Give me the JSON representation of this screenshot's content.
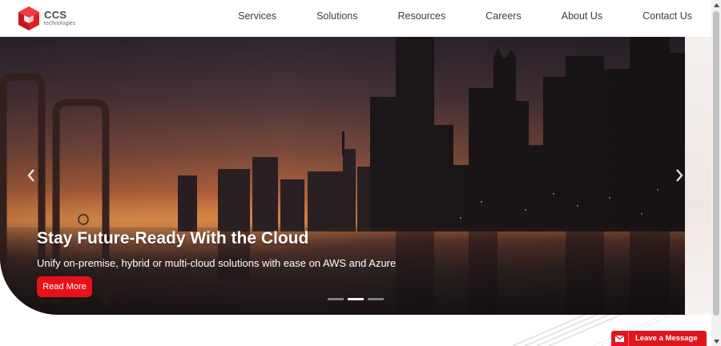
{
  "brand": {
    "name": "CCS",
    "tagline": "technologies",
    "color": "#e31e24"
  },
  "nav": {
    "items": [
      "Services",
      "Solutions",
      "Resources",
      "Careers",
      "About Us",
      "Contact Us"
    ]
  },
  "hero": {
    "title": "Stay Future-Ready With the Cloud",
    "subtitle": "Unify on-premise, hybrid or multi-cloud solutions with ease on AWS and Azure",
    "button_label": "Read More",
    "slide_count": 3,
    "active_slide": 2,
    "prev_icon": "chevron-left-icon",
    "next_icon": "chevron-right-icon"
  },
  "widget": {
    "label": "Leave a Message",
    "icon": "envelope-icon",
    "color": "#e0161e"
  }
}
